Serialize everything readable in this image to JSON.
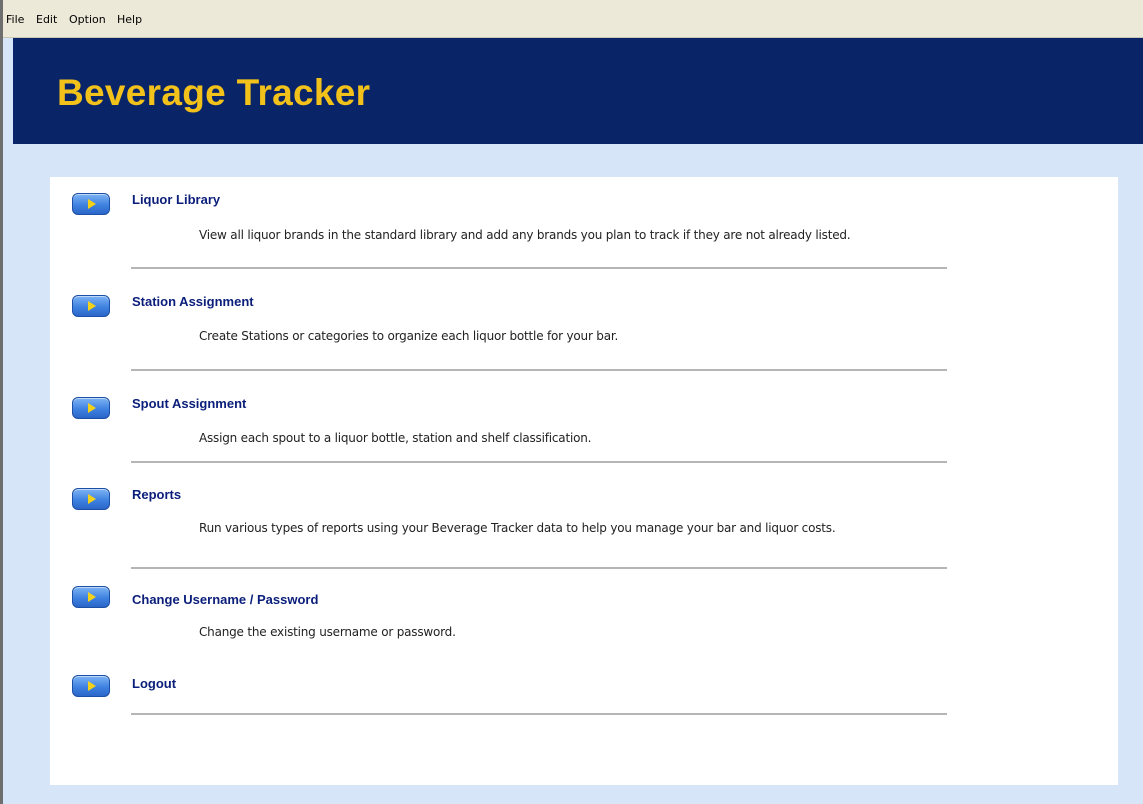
{
  "menubar": {
    "items": [
      "File",
      "Edit",
      "Option",
      "Help"
    ]
  },
  "header": {
    "title": "Beverage Tracker"
  },
  "nav": {
    "items": [
      {
        "title": "Liquor Library",
        "description": "View all liquor brands in the standard library and add any brands you plan to track if they are not already listed."
      },
      {
        "title": "Station Assignment",
        "description": "Create Stations or categories to organize each liquor bottle for your bar."
      },
      {
        "title": "Spout Assignment",
        "description": "Assign each spout to a liquor bottle, station and shelf classification."
      },
      {
        "title": "Reports",
        "description": "Run various types of reports using your Beverage Tracker data to help you manage your bar and liquor costs."
      },
      {
        "title": "Change Username / Password",
        "description": "Change the existing username or password."
      },
      {
        "title": "Logout",
        "description": ""
      }
    ]
  },
  "colors": {
    "header_bg": "#0a2468",
    "title_text": "#f2c21b",
    "window_bg": "#d6e6f8",
    "link_text": "#0a1e7a",
    "button_blue": "#3f82e0",
    "button_arrow": "#f4d21a"
  },
  "icons": {
    "nav_button": "play-arrow-icon"
  }
}
